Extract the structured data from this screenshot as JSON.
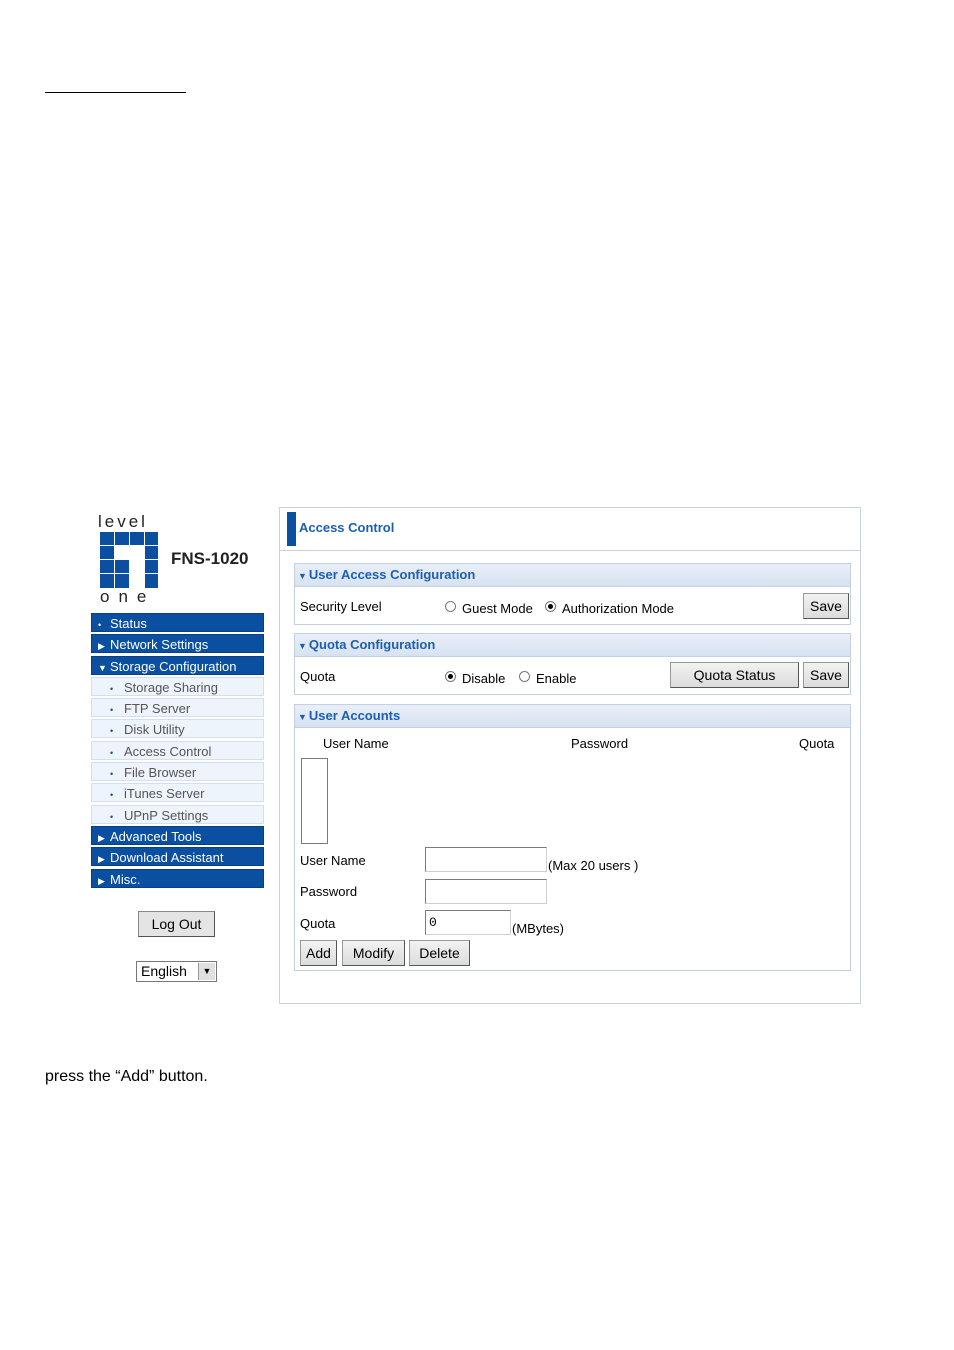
{
  "logo": {
    "word_top": "level",
    "word_bottom": "one",
    "model": "FNS-1020",
    "brand_color": "#0a4fa0"
  },
  "sidebar": {
    "items": [
      {
        "label": "Status",
        "type": "main",
        "icon": "bullet"
      },
      {
        "label": "Network Settings",
        "type": "main",
        "icon": "triangle-right"
      },
      {
        "label": "Storage Configuration",
        "type": "main",
        "icon": "triangle-down"
      },
      {
        "label": "Storage Sharing",
        "type": "sub"
      },
      {
        "label": "FTP Server",
        "type": "sub"
      },
      {
        "label": "Disk Utility",
        "type": "sub"
      },
      {
        "label": "Access Control",
        "type": "sub"
      },
      {
        "label": "File Browser",
        "type": "sub"
      },
      {
        "label": "iTunes Server",
        "type": "sub"
      },
      {
        "label": "UPnP Settings",
        "type": "sub"
      },
      {
        "label": "Advanced Tools",
        "type": "main",
        "icon": "triangle-right"
      },
      {
        "label": "Download Assistant",
        "type": "main",
        "icon": "triangle-right"
      },
      {
        "label": "Misc.",
        "type": "main",
        "icon": "triangle-right"
      }
    ],
    "logout_label": "Log Out",
    "language": "English"
  },
  "panel": {
    "title": "Access Control",
    "user_access": {
      "header": "User Access Configuration",
      "label": "Security Level",
      "option_guest": "Guest Mode",
      "option_auth": "Authorization Mode",
      "selected": "Authorization Mode",
      "save_label": "Save"
    },
    "quota_config": {
      "header": "Quota Configuration",
      "label": "Quota",
      "option_disable": "Disable",
      "option_enable": "Enable",
      "selected": "Disable",
      "status_label": "Quota Status",
      "save_label": "Save"
    },
    "user_accounts": {
      "header": "User Accounts",
      "col_username": "User Name",
      "col_password": "Password",
      "col_quota": "Quota",
      "username_label": "User Name",
      "username_value": "",
      "username_hint": "(Max 20 users )",
      "password_label": "Password",
      "password_value": "",
      "quota_label": "Quota",
      "quota_value": "0",
      "quota_unit": "(MBytes)",
      "add_label": "Add",
      "modify_label": "Modify",
      "delete_label": "Delete"
    }
  },
  "caption": "press the “Add” button."
}
